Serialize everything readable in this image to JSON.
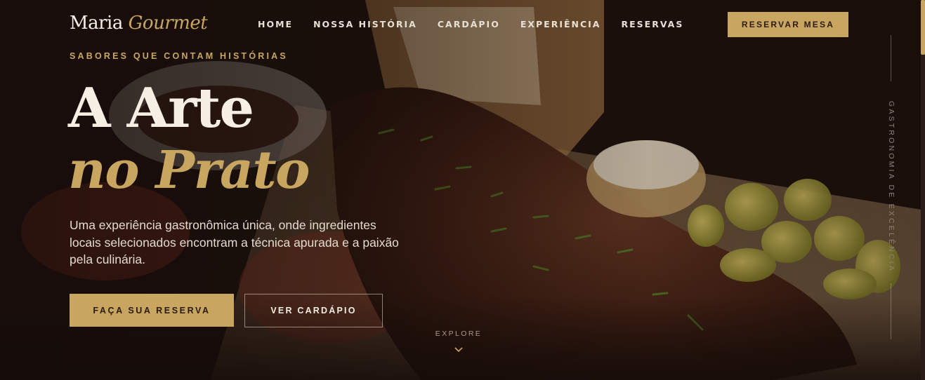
{
  "brand": {
    "name": "Maria",
    "name_accent": "Gourmet"
  },
  "nav": {
    "items": [
      {
        "label": "HOME"
      },
      {
        "label": "NOSSA HISTÓRIA"
      },
      {
        "label": "CARDÁPIO"
      },
      {
        "label": "EXPERIÊNCIA"
      },
      {
        "label": "RESERVAS"
      }
    ],
    "cta_label": "RESERVAR MESA"
  },
  "hero": {
    "eyebrow": "SABORES QUE CONTAM HISTÓRIAS",
    "title_line1": "A Arte",
    "title_line2": "no Prato",
    "lead": "Uma experiência gastronômica única, onde ingredientes locais selecionados encontram a técnica apurada e a paixão pela culinária.",
    "primary_button": "FAÇA SUA RESERVA",
    "secondary_button": "VER CARDÁPIO"
  },
  "explore": {
    "label": "EXPLORE",
    "icon": "chevron-down-icon"
  },
  "side_rail": {
    "text": "GASTRONOMIA DE EXCELÊNCIA"
  },
  "colors": {
    "accent": "#c9a65f",
    "background": "#1a0f0c",
    "text": "#f3ece2"
  }
}
